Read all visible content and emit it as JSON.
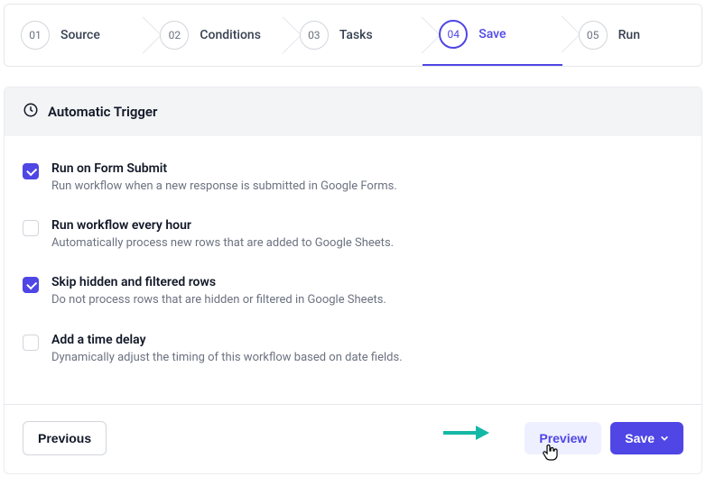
{
  "stepper": {
    "steps": [
      {
        "num": "01",
        "label": "Source",
        "active": false
      },
      {
        "num": "02",
        "label": "Conditions",
        "active": false
      },
      {
        "num": "03",
        "label": "Tasks",
        "active": false
      },
      {
        "num": "04",
        "label": "Save",
        "active": true
      },
      {
        "num": "05",
        "label": "Run",
        "active": false
      }
    ]
  },
  "panel": {
    "title": "Automatic Trigger"
  },
  "options": [
    {
      "title": "Run on Form Submit",
      "desc": "Run workflow when a new response is submitted in Google Forms.",
      "checked": true
    },
    {
      "title": "Run workflow every hour",
      "desc": "Automatically process new rows that are added to Google Sheets.",
      "checked": false
    },
    {
      "title": "Skip hidden and filtered rows",
      "desc": "Do not process rows that are hidden or filtered in Google Sheets.",
      "checked": true
    },
    {
      "title": "Add a time delay",
      "desc": "Dynamically adjust the timing of this workflow based on date fields.",
      "checked": false
    }
  ],
  "footer": {
    "previous": "Previous",
    "preview": "Preview",
    "save": "Save"
  },
  "colors": {
    "primary": "#4f46e5",
    "arrow": "#14b8a6"
  }
}
